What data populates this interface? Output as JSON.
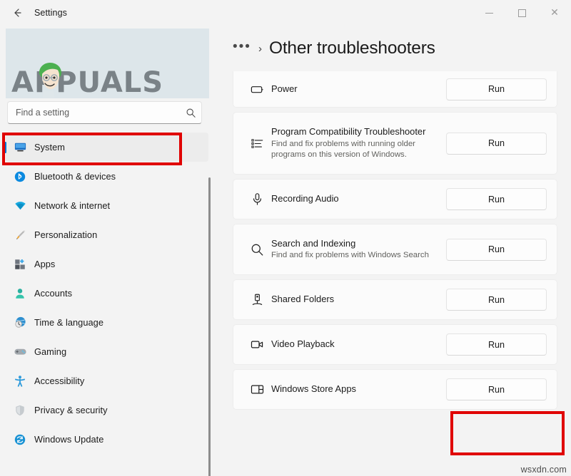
{
  "window": {
    "title": "Settings",
    "back_icon": "back-arrow-icon",
    "minimize_label": "Minimize",
    "maximize_label": "Maximize",
    "close_label": "Close"
  },
  "brand": {
    "wordmark": "APPUALS",
    "banner_color": "#dde6ea",
    "wordmark_color": "#7a8287"
  },
  "search": {
    "placeholder": "Find a setting",
    "value": "",
    "icon": "search-icon"
  },
  "sidebar": {
    "items": [
      {
        "label": "System",
        "icon": "monitor-icon",
        "selected": true
      },
      {
        "label": "Bluetooth & devices",
        "icon": "bluetooth-icon",
        "selected": false
      },
      {
        "label": "Network & internet",
        "icon": "wifi-icon",
        "selected": false
      },
      {
        "label": "Personalization",
        "icon": "paintbrush-icon",
        "selected": false
      },
      {
        "label": "Apps",
        "icon": "apps-grid-icon",
        "selected": false
      },
      {
        "label": "Accounts",
        "icon": "person-icon",
        "selected": false
      },
      {
        "label": "Time & language",
        "icon": "clock-globe-icon",
        "selected": false
      },
      {
        "label": "Gaming",
        "icon": "gamepad-icon",
        "selected": false
      },
      {
        "label": "Accessibility",
        "icon": "accessibility-icon",
        "selected": false
      },
      {
        "label": "Privacy & security",
        "icon": "shield-icon",
        "selected": false
      },
      {
        "label": "Windows Update",
        "icon": "update-refresh-icon",
        "selected": false
      }
    ]
  },
  "main": {
    "breadcrumb": {
      "overflow": "•••",
      "separator": "›",
      "title": "Other troubleshooters"
    },
    "run_label": "Run",
    "troubleshooters": [
      {
        "name": "Power",
        "description": "",
        "icon": "battery-icon",
        "run_label": "Run",
        "clipped": true
      },
      {
        "name": "Program Compatibility Troubleshooter",
        "description": "Find and fix problems with running older programs on this version of Windows.",
        "icon": "list-icon",
        "run_label": "Run",
        "clipped": false
      },
      {
        "name": "Recording Audio",
        "description": "",
        "icon": "microphone-icon",
        "run_label": "Run",
        "clipped": false
      },
      {
        "name": "Search and Indexing",
        "description": "Find and fix problems with Windows Search",
        "icon": "search-icon",
        "run_label": "Run",
        "clipped": false
      },
      {
        "name": "Shared Folders",
        "description": "",
        "icon": "shared-folder-icon",
        "run_label": "Run",
        "clipped": false
      },
      {
        "name": "Video Playback",
        "description": "",
        "icon": "video-camera-icon",
        "run_label": "Run",
        "clipped": false
      },
      {
        "name": "Windows Store Apps",
        "description": "",
        "icon": "store-window-icon",
        "run_label": "Run",
        "clipped": false
      }
    ]
  },
  "annotations": {
    "color": "#e00000",
    "boxes": [
      {
        "id": "annot-system",
        "target": "sidebar-item-system"
      },
      {
        "id": "annot-store-run",
        "target": "run-button-windows-store-apps"
      }
    ]
  },
  "watermark": {
    "text": "wsxdn.com"
  }
}
